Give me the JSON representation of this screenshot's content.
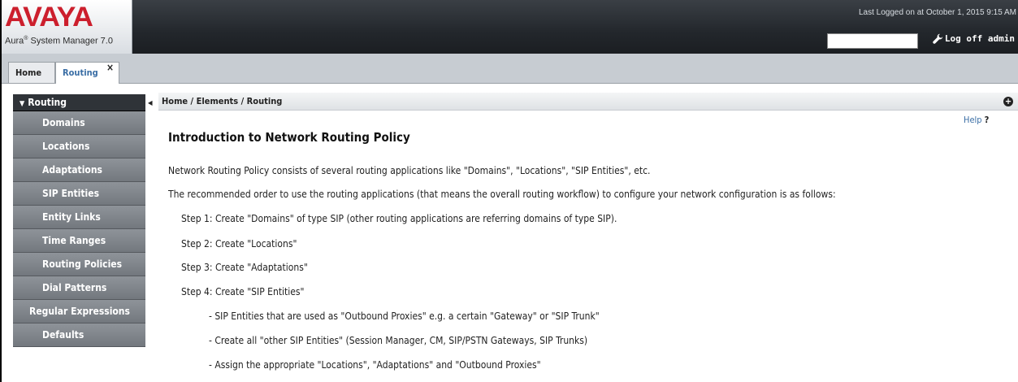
{
  "header": {
    "logo": "AVAYA",
    "product_name": "Aura",
    "product_reg": "®",
    "product_suffix": " System Manager 7.0",
    "last_logged": "Last Logged on at October 1, 2015 9:15 AM",
    "search_value": "",
    "logoff_label": "Log off admin",
    "logoff_icon": "wrench-icon",
    "brand_color": "#cc1f2d"
  },
  "tabs": [
    {
      "label": "Home"
    },
    {
      "label": "Routing",
      "close": "×"
    }
  ],
  "sidebar": {
    "title": "Routing",
    "items": [
      {
        "label": "Domains"
      },
      {
        "label": "Locations"
      },
      {
        "label": "Adaptations"
      },
      {
        "label": "SIP Entities"
      },
      {
        "label": "Entity Links"
      },
      {
        "label": "Time Ranges"
      },
      {
        "label": "Routing Policies"
      },
      {
        "label": "Dial Patterns"
      },
      {
        "label": "Regular Expressions"
      },
      {
        "label": "Defaults"
      }
    ]
  },
  "main": {
    "breadcrumb": "Home / Elements / Routing",
    "help": "Help",
    "help_mark": "?",
    "title": "Introduction to Network Routing Policy",
    "lines": [
      "Network Routing Policy consists of several routing applications like \"Domains\", \"Locations\", \"SIP Entities\", etc.",
      "The recommended order to use the routing applications (that means the overall routing workflow) to configure your network configuration is as follows:",
      "Step 1: Create \"Domains\" of type SIP (other routing applications are referring domains of type SIP).",
      "Step 2: Create \"Locations\"",
      "Step 3: Create \"Adaptations\"",
      "Step 4: Create \"SIP Entities\"",
      "- SIP Entities that are used as \"Outbound Proxies\" e.g. a certain \"Gateway\" or \"SIP Trunk\"",
      "- Create all \"other SIP Entities\" (Session Manager, CM, SIP/PSTN Gateways, SIP Trunks)",
      "- Assign the appropriate \"Locations\", \"Adaptations\" and \"Outbound Proxies\""
    ]
  }
}
